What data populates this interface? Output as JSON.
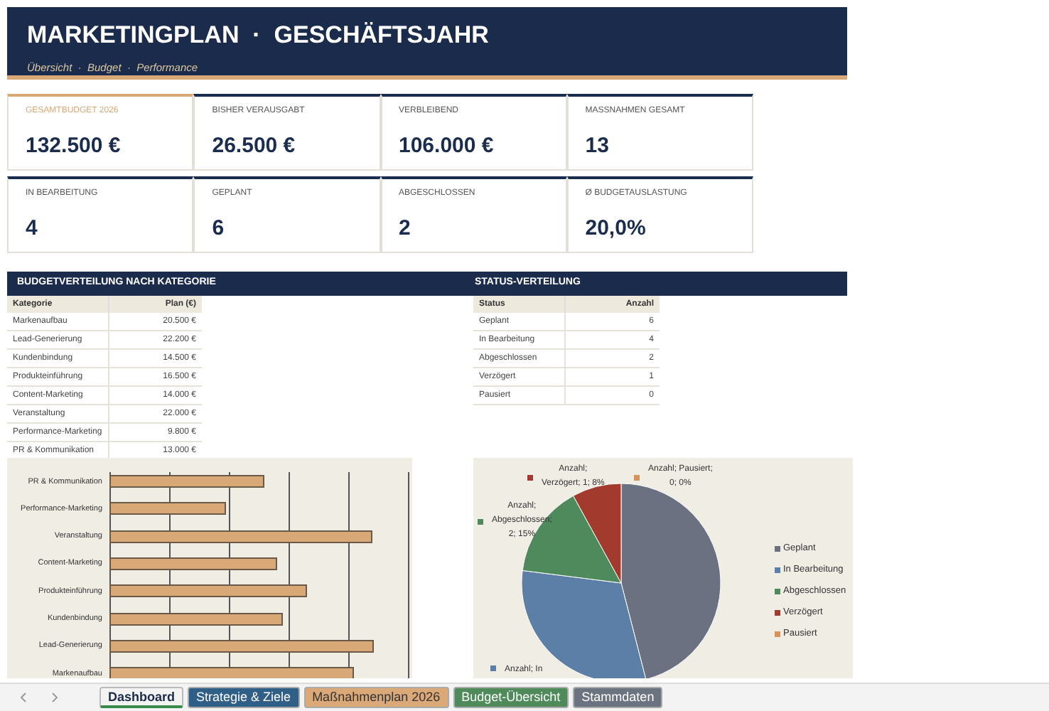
{
  "header": {
    "title": "MARKETINGPLAN  ·  GESCHÄFTSJAHR",
    "subtitle": "Übersicht  ·  Budget  ·  Performance"
  },
  "kpi_rows": [
    [
      {
        "label": "GESAMTBUDGET 2026",
        "value": "132.500 €",
        "highlighted": true
      },
      {
        "label": "BISHER VERAUSGABT",
        "value": "26.500 €",
        "highlighted": false
      },
      {
        "label": "VERBLEIBEND",
        "value": "106.000 €",
        "highlighted": false
      },
      {
        "label": "MASSNAHMEN GESAMT",
        "value": "13",
        "highlighted": false
      }
    ],
    [
      {
        "label": "IN BEARBEITUNG",
        "value": "4",
        "highlighted": false
      },
      {
        "label": "GEPLANT",
        "value": "6",
        "highlighted": false
      },
      {
        "label": "ABGESCHLOSSEN",
        "value": "2",
        "highlighted": false
      },
      {
        "label": "Ø BUDGETAUSLASTUNG",
        "value": "20,0%",
        "highlighted": false
      }
    ]
  ],
  "budget_section": {
    "title": "BUDGETVERTEILUNG NACH KATEGORIE",
    "columns": [
      "Kategorie",
      "Plan (€)"
    ],
    "rows": [
      [
        "Markenaufbau",
        "20.500 €"
      ],
      [
        "Lead-Generierung",
        "22.200 €"
      ],
      [
        "Kundenbindung",
        "14.500 €"
      ],
      [
        "Produkteinführung",
        "16.500 €"
      ],
      [
        "Content-Marketing",
        "14.000 €"
      ],
      [
        "Veranstaltung",
        "22.000 €"
      ],
      [
        "Performance-Marketing",
        "9.800 €"
      ],
      [
        "PR & Kommunikation",
        "13.000 €"
      ]
    ],
    "bar_chart": {
      "categories": [
        "PR & Kommunikation",
        "Performance-Marketing",
        "Veranstaltung",
        "Content-Marketing",
        "Produkteinführung",
        "Kundenbindung",
        "Lead-Generierung",
        "Markenaufbau"
      ]
    }
  },
  "status_section": {
    "title": "STATUS-VERTEILUNG",
    "columns": [
      "Status",
      "Anzahl"
    ],
    "rows": [
      [
        "Geplant",
        "6"
      ],
      [
        "In Bearbeitung",
        "4"
      ],
      [
        "Abgeschlossen",
        "2"
      ],
      [
        "Verzögert",
        "1"
      ],
      [
        "Pausiert",
        "0"
      ]
    ],
    "chart_data": {
      "type": "pie",
      "categories": [
        "Geplant",
        "In Bearbeitung",
        "Abgeschlossen",
        "Verzögert",
        "Pausiert"
      ],
      "series": [
        {
          "values": [
            46,
            31,
            15,
            8,
            0
          ]
        }
      ],
      "colors": [
        "#6b7180",
        "#5b7fa6",
        "#4e8a5c",
        "#a33a2e",
        "#d9915a"
      ],
      "legend": "right",
      "data_labels": [
        {
          "lines": [
            "Anzahl; In"
          ],
          "color": "#5b7fa6"
        },
        {
          "lines": [
            "Anzahl;",
            "Abgeschlossen;",
            "2; 15%"
          ],
          "color": "#4e8a5c"
        },
        {
          "lines": [
            "Anzahl;",
            "Verzögert; 1; 8%"
          ],
          "color": "#a33a2e"
        },
        {
          "lines": [
            "Anzahl; Pausiert;",
            "0; 0%"
          ],
          "color": "#d9915a"
        }
      ]
    }
  },
  "sheet_tabs": [
    {
      "label": "Dashboard",
      "selected": true,
      "color": "#f3f3f3"
    },
    {
      "label": "Strategie & Ziele",
      "selected": false,
      "color": "#2f5f86"
    },
    {
      "label": "Maßnahmenplan 2026",
      "selected": false,
      "color": "#dba878"
    },
    {
      "label": "Budget-Übersicht",
      "selected": false,
      "color": "#4f8a5b"
    },
    {
      "label": "Stammdaten",
      "selected": false,
      "color": "#6b7280"
    }
  ]
}
